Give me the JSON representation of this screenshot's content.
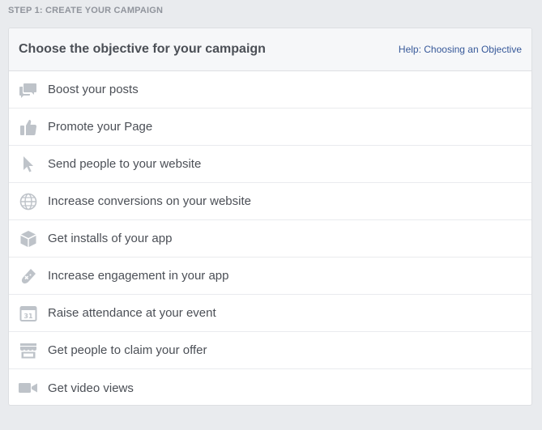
{
  "step_label": "STEP 1: CREATE YOUR CAMPAIGN",
  "panel": {
    "title": "Choose the objective for your campaign",
    "help_link": "Help: Choosing an Objective"
  },
  "icon_color": "#bec3c9",
  "objectives": [
    {
      "label": "Boost your posts",
      "icon": "speech-bubbles-icon"
    },
    {
      "label": "Promote your Page",
      "icon": "thumbs-up-icon"
    },
    {
      "label": "Send people to your website",
      "icon": "cursor-arrow-icon"
    },
    {
      "label": "Increase conversions on your website",
      "icon": "globe-icon"
    },
    {
      "label": "Get installs of your app",
      "icon": "cube-icon"
    },
    {
      "label": "Increase engagement in your app",
      "icon": "game-controller-icon"
    },
    {
      "label": "Raise attendance at your event",
      "icon": "calendar-icon"
    },
    {
      "label": "Get people to claim your offer",
      "icon": "storefront-icon"
    },
    {
      "label": "Get video views",
      "icon": "video-camera-icon"
    }
  ]
}
